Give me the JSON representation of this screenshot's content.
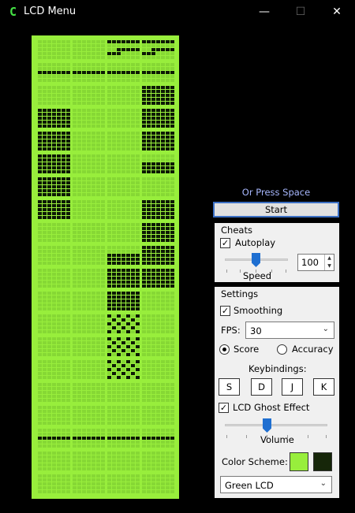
{
  "window": {
    "icon_glyph": "C",
    "title": "LCD Menu",
    "min_glyph": "—",
    "max_glyph": "☐",
    "close_glyph": "✕"
  },
  "prompt": "Or Press Space",
  "start_label": "Start",
  "cheats": {
    "title": "Cheats",
    "autoplay_label": "Autoplay",
    "autoplay_checked": true,
    "speed_label": "Speed",
    "speed_value": "100",
    "speed_level": 0.5
  },
  "settings": {
    "title": "Settings",
    "smoothing_label": "Smoothing",
    "smoothing_checked": true,
    "fps_label": "FPS:",
    "fps_value": "30",
    "score_label": "Score",
    "accuracy_label": "Accuracy",
    "selected_mode": "Score",
    "keybindings_label": "Keybindings:",
    "keys": [
      "S",
      "D",
      "J",
      "K"
    ],
    "ghost_label": "LCD Ghost Effect",
    "ghost_checked": true,
    "volume_label": "Volume",
    "volume_level": 0.5,
    "color_scheme_label": "Color Scheme:",
    "color_scheme_value": "Green LCD"
  },
  "colors": {
    "lcd_bg": "#98ee3c",
    "lcd_off": "#86d834",
    "lcd_on": "#0d1a05",
    "swatch_light": "#98ee3c",
    "swatch_dark": "#162609",
    "accent": "#1f6fd1"
  }
}
